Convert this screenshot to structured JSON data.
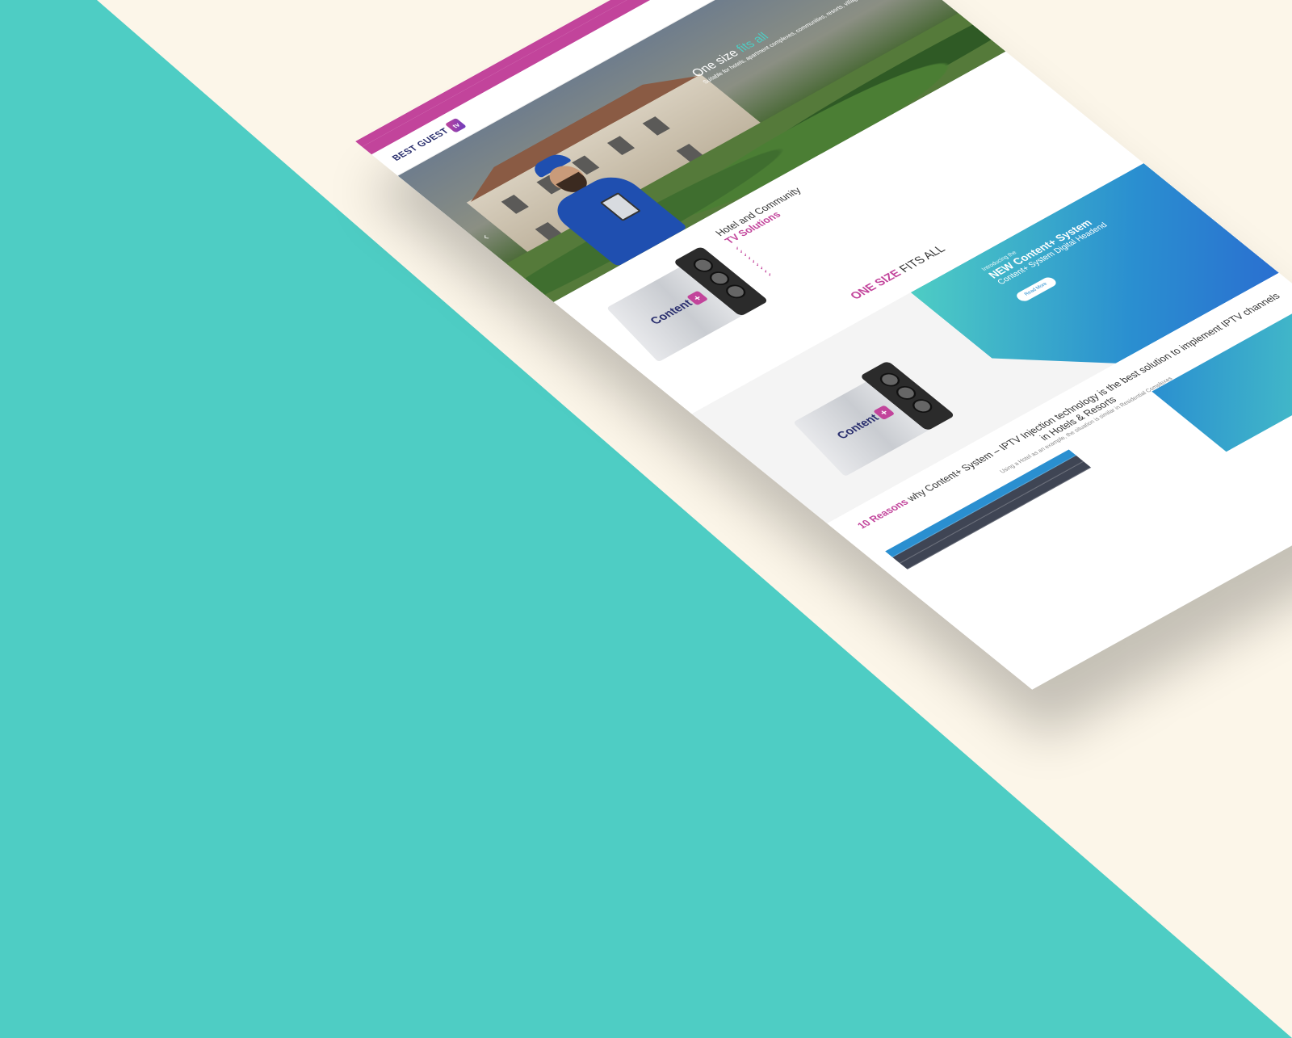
{
  "utility_bar": {
    "phone": "",
    "email": ""
  },
  "header": {
    "logo_text": "BEST GUEST",
    "logo_badge": "tv",
    "logo_tagline": "",
    "nav": [
      {
        "label": "",
        "active": true
      },
      {
        "label": ""
      },
      {
        "label": ""
      },
      {
        "label": ""
      },
      {
        "label": ""
      },
      {
        "label": ""
      }
    ]
  },
  "hero": {
    "title_prefix": "One size ",
    "title_accent": "fits all",
    "subtitle": "Suitable for hotels, apartment complexes, communities, resorts, villages and more!",
    "prev_arrow": "‹",
    "next_arrow": "›"
  },
  "solutions": {
    "title_line1": "Hotel and Community",
    "title_line2": "TV Solutions",
    "description": "",
    "checklist": [
      "",
      "",
      "",
      "",
      "",
      "",
      "",
      "",
      ""
    ],
    "product_label": "Content",
    "product_plus": "+"
  },
  "one_size": {
    "title_accent": "ONE SIZE",
    "title_rest": " FITS ALL",
    "paragraphs": [
      "",
      "",
      ""
    ],
    "link_text": ""
  },
  "intro": {
    "pre": "Introducing the",
    "title": "NEW Content+ System",
    "subtitle": "Content+ System Digital Headend",
    "paragraphs": [
      "",
      ""
    ],
    "button": "Read More"
  },
  "reasons": {
    "title_accent": "10 Reasons",
    "title_rest": " why Content+ System – IPTV Injection technology is the best solution to implement IPTV channels in Hotels & Resorts",
    "subtitle": "Using a Hotel as an example, the situation is similar in Residential Complexes",
    "items": [
      "",
      "",
      ""
    ],
    "panel_text": ""
  }
}
